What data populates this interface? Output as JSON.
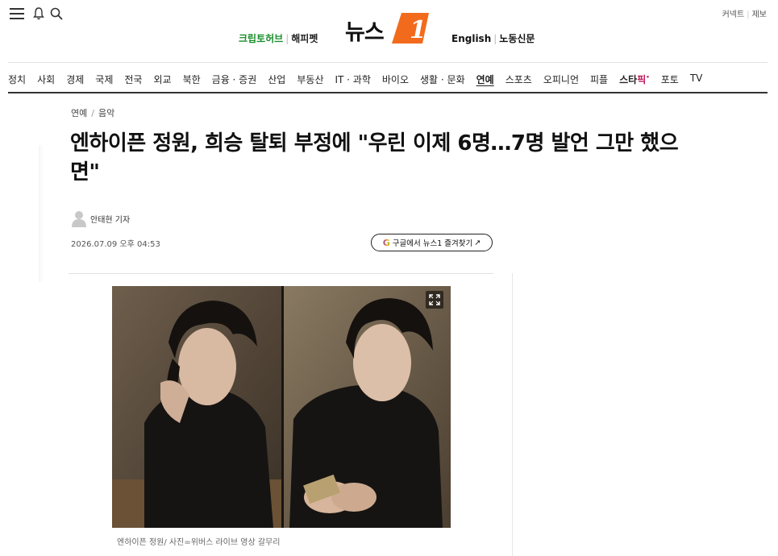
{
  "header": {
    "partners": [
      {
        "label": "크립토허브",
        "color": "#1a8f2c"
      },
      {
        "label": "해피펫",
        "color": "#222222"
      }
    ],
    "logo_text": "뉴스",
    "logo_mark": "1",
    "languages": [
      "English",
      "노동신문"
    ],
    "utility": [
      "커넥트",
      "제보"
    ],
    "icons": [
      "menu-icon",
      "bell-icon",
      "search-icon"
    ]
  },
  "nav": {
    "items": [
      "정치",
      "사회",
      "경제",
      "국제",
      "전국",
      "외교",
      "북한",
      "금융 · 증권",
      "산업",
      "부동산",
      "IT · 과학",
      "바이오",
      "생활 · 문화",
      "연예",
      "스포츠",
      "오피니언",
      "피플",
      "스타",
      "픽",
      "포토",
      "TV"
    ],
    "active": "연예",
    "star_label": "스타",
    "star_pick": "픽"
  },
  "article": {
    "breadcrumb": [
      "연예",
      "음악"
    ],
    "title": "엔하이픈 정원, 희승 탈퇴 부정에 \"우린 이제 6명…7명 발언 그만 했으면\"",
    "reporter": "안태현 기자",
    "datetime": "2026.07.09 오후 04:53",
    "google_button": "구글에서 뉴스1 즐겨찾기",
    "google_icon": "G",
    "google_arrow": "↗",
    "caption": "엔하이픈 정원/ 사진=위버스 라이브 영상 갈무리"
  },
  "colors": {
    "accent": "#f26b1d",
    "partner_green": "#1a8f2c",
    "star_pink": "#c2185b"
  }
}
